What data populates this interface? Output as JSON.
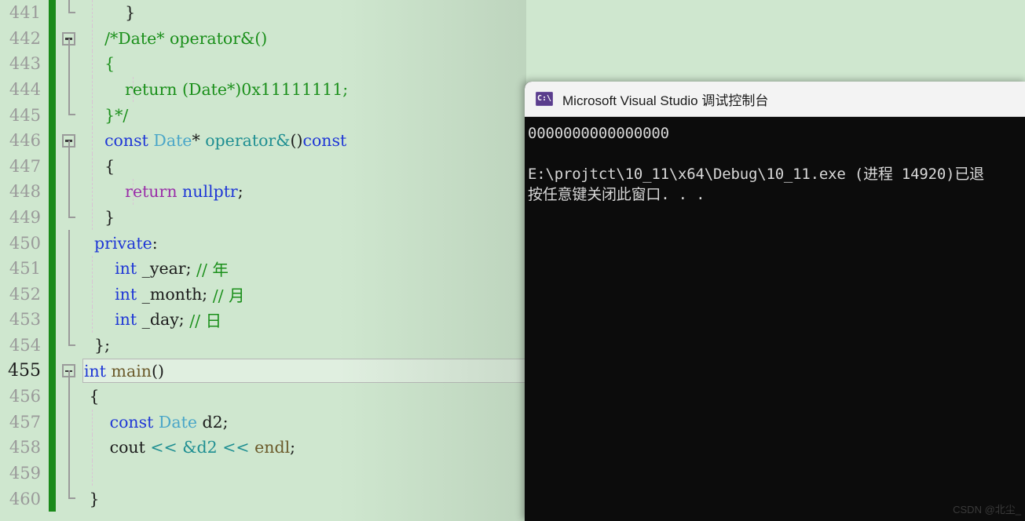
{
  "editor": {
    "name": "visual-studio-code-editor",
    "background_color": "#cfe7cf",
    "change_bar_color": "#1a8a1a",
    "current_line": 455,
    "lines": [
      {
        "number": "441",
        "fold": "end",
        "indent_guides": 1,
        "tokens": [
          {
            "t": "        }",
            "c": "plain"
          }
        ]
      },
      {
        "number": "442",
        "fold": "open",
        "indent_guides": 1,
        "tokens": [
          {
            "t": "    /*Date* operator&()",
            "c": "cmt"
          }
        ]
      },
      {
        "number": "443",
        "fold": "line",
        "indent_guides": 1,
        "tokens": [
          {
            "t": "    {",
            "c": "cmt"
          }
        ]
      },
      {
        "number": "444",
        "fold": "line",
        "indent_guides": 2,
        "tokens": [
          {
            "t": "        return (Date*)0x11111111;",
            "c": "cmt"
          }
        ]
      },
      {
        "number": "445",
        "fold": "end",
        "indent_guides": 1,
        "tokens": [
          {
            "t": "    }*/",
            "c": "cmt"
          }
        ]
      },
      {
        "number": "446",
        "fold": "open",
        "indent_guides": 1,
        "tokens": [
          {
            "t": "    ",
            "c": "plain"
          },
          {
            "t": "const",
            "c": "kw"
          },
          {
            "t": " ",
            "c": "plain"
          },
          {
            "t": "Date",
            "c": "type"
          },
          {
            "t": "* ",
            "c": "plain"
          },
          {
            "t": "operator&",
            "c": "fn"
          },
          {
            "t": "()",
            "c": "plain"
          },
          {
            "t": "const",
            "c": "kw"
          }
        ]
      },
      {
        "number": "447",
        "fold": "line",
        "indent_guides": 1,
        "tokens": [
          {
            "t": "    {",
            "c": "plain"
          }
        ]
      },
      {
        "number": "448",
        "fold": "line",
        "indent_guides": 2,
        "tokens": [
          {
            "t": "        ",
            "c": "plain"
          },
          {
            "t": "return",
            "c": "ret"
          },
          {
            "t": " ",
            "c": "plain"
          },
          {
            "t": "nullptr",
            "c": "kw"
          },
          {
            "t": ";",
            "c": "plain"
          }
        ]
      },
      {
        "number": "449",
        "fold": "end",
        "indent_guides": 1,
        "tokens": [
          {
            "t": "    }",
            "c": "plain"
          }
        ]
      },
      {
        "number": "450",
        "fold": "line",
        "indent_guides": 0,
        "tokens": [
          {
            "t": "  ",
            "c": "plain"
          },
          {
            "t": "private",
            "c": "kw"
          },
          {
            "t": ":",
            "c": "plain"
          }
        ]
      },
      {
        "number": "451",
        "fold": "line",
        "indent_guides": 1,
        "tokens": [
          {
            "t": "      ",
            "c": "plain"
          },
          {
            "t": "int",
            "c": "kw"
          },
          {
            "t": " _year; ",
            "c": "plain"
          },
          {
            "t": "// 年",
            "c": "cmt"
          }
        ]
      },
      {
        "number": "452",
        "fold": "line",
        "indent_guides": 1,
        "tokens": [
          {
            "t": "      ",
            "c": "plain"
          },
          {
            "t": "int",
            "c": "kw"
          },
          {
            "t": " _month; ",
            "c": "plain"
          },
          {
            "t": "// 月",
            "c": "cmt"
          }
        ]
      },
      {
        "number": "453",
        "fold": "line",
        "indent_guides": 1,
        "tokens": [
          {
            "t": "      ",
            "c": "plain"
          },
          {
            "t": "int",
            "c": "kw"
          },
          {
            "t": " _day; ",
            "c": "plain"
          },
          {
            "t": "// 日",
            "c": "cmt"
          }
        ]
      },
      {
        "number": "454",
        "fold": "end",
        "indent_guides": 0,
        "tokens": [
          {
            "t": "  };",
            "c": "plain"
          }
        ]
      },
      {
        "number": "455",
        "fold": "open",
        "indent_guides": 0,
        "current": true,
        "tokens": [
          {
            "t": "int",
            "c": "kw"
          },
          {
            "t": " ",
            "c": "plain"
          },
          {
            "t": "main",
            "c": "endl"
          },
          {
            "t": "()",
            "c": "plain"
          }
        ]
      },
      {
        "number": "456",
        "fold": "line",
        "indent_guides": 0,
        "tokens": [
          {
            "t": " {",
            "c": "plain"
          }
        ]
      },
      {
        "number": "457",
        "fold": "line",
        "indent_guides": 1,
        "tokens": [
          {
            "t": "     ",
            "c": "plain"
          },
          {
            "t": "const",
            "c": "kw"
          },
          {
            "t": " ",
            "c": "plain"
          },
          {
            "t": "Date",
            "c": "type"
          },
          {
            "t": " d2;",
            "c": "plain"
          }
        ]
      },
      {
        "number": "458",
        "fold": "line",
        "indent_guides": 1,
        "tokens": [
          {
            "t": "     cout ",
            "c": "plain"
          },
          {
            "t": "<<",
            "c": "op"
          },
          {
            "t": " ",
            "c": "plain"
          },
          {
            "t": "&d2",
            "c": "fn"
          },
          {
            "t": " ",
            "c": "plain"
          },
          {
            "t": "<<",
            "c": "op"
          },
          {
            "t": " ",
            "c": "plain"
          },
          {
            "t": "endl",
            "c": "endl"
          },
          {
            "t": ";",
            "c": "plain"
          }
        ]
      },
      {
        "number": "459",
        "fold": "line",
        "indent_guides": 1,
        "tokens": [
          {
            "t": "",
            "c": "plain"
          }
        ]
      },
      {
        "number": "460",
        "fold": "endlast",
        "indent_guides": 0,
        "tokens": [
          {
            "t": " }",
            "c": "plain"
          }
        ]
      }
    ]
  },
  "console": {
    "name": "vs-debug-console-window",
    "icon_label": "C:\\",
    "title": "Microsoft Visual Studio 调试控制台",
    "background_color": "#0c0c0c",
    "titlebar_color": "#f3f3f3",
    "output_lines": [
      "0000000000000000",
      "",
      "E:\\projtct\\10_11\\x64\\Debug\\10_11.exe (进程 14920)已退",
      "按任意键关闭此窗口. . ."
    ]
  },
  "watermark": {
    "text": "CSDN @北尘_"
  }
}
